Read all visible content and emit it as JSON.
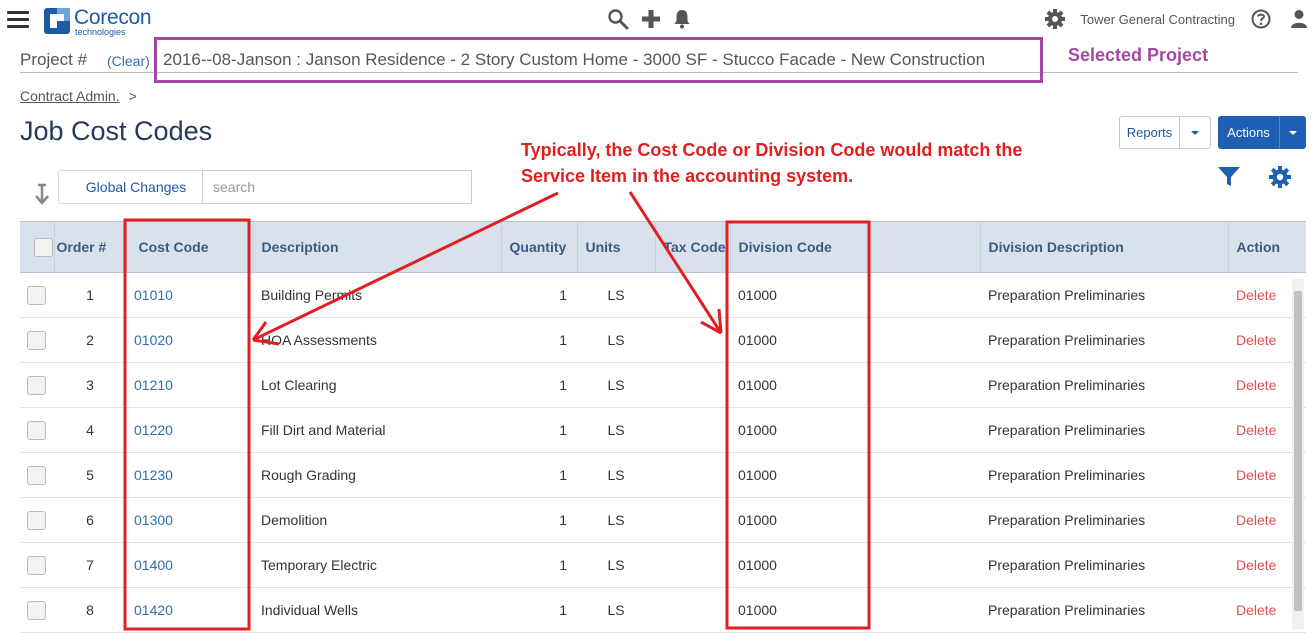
{
  "app": {
    "logo_name": "Corecon",
    "logo_sub": "technologies",
    "company": "Tower General Contracting"
  },
  "project": {
    "label": "Project #",
    "clear": "(Clear)",
    "name": "2016--08-Janson : Janson Residence - 2 Story Custom Home - 3000 SF - Stucco Facade - New Construction",
    "callout": "Selected Project"
  },
  "breadcrumb": {
    "item": "Contract Admin.",
    "separator": ">"
  },
  "page_title": "Job Cost Codes",
  "buttons": {
    "reports": "Reports",
    "actions": "Actions",
    "global_changes": "Global Changes"
  },
  "search": {
    "placeholder": "search"
  },
  "annotation": {
    "line1": "Typically, the Cost Code or Division Code would match the",
    "line2": "Service Item in the accounting system."
  },
  "table": {
    "headers": {
      "order": "Order #",
      "cost_code": "Cost Code",
      "description": "Description",
      "quantity": "Quantity",
      "units": "Units",
      "tax_code": "Tax Code",
      "division_code": "Division Code",
      "division_description": "Division Description",
      "action": "Action"
    },
    "rows": [
      {
        "order": "1",
        "cost_code": "01010",
        "description": "Building Permits",
        "quantity": "1",
        "units": "LS",
        "division_code": "01000",
        "division_description": "Preparation Preliminaries",
        "action": "Delete"
      },
      {
        "order": "2",
        "cost_code": "01020",
        "description": "HOA Assessments",
        "quantity": "1",
        "units": "LS",
        "division_code": "01000",
        "division_description": "Preparation Preliminaries",
        "action": "Delete"
      },
      {
        "order": "3",
        "cost_code": "01210",
        "description": "Lot Clearing",
        "quantity": "1",
        "units": "LS",
        "division_code": "01000",
        "division_description": "Preparation Preliminaries",
        "action": "Delete"
      },
      {
        "order": "4",
        "cost_code": "01220",
        "description": "Fill Dirt and Material",
        "quantity": "1",
        "units": "LS",
        "division_code": "01000",
        "division_description": "Preparation Preliminaries",
        "action": "Delete"
      },
      {
        "order": "5",
        "cost_code": "01230",
        "description": "Rough Grading",
        "quantity": "1",
        "units": "LS",
        "division_code": "01000",
        "division_description": "Preparation Preliminaries",
        "action": "Delete"
      },
      {
        "order": "6",
        "cost_code": "01300",
        "description": "Demolition",
        "quantity": "1",
        "units": "LS",
        "division_code": "01000",
        "division_description": "Preparation Preliminaries",
        "action": "Delete"
      },
      {
        "order": "7",
        "cost_code": "01400",
        "description": "Temporary Electric",
        "quantity": "1",
        "units": "LS",
        "division_code": "01000",
        "division_description": "Preparation Preliminaries",
        "action": "Delete"
      },
      {
        "order": "8",
        "cost_code": "01420",
        "description": "Individual Wells",
        "quantity": "1",
        "units": "LS",
        "division_code": "01000",
        "division_description": "Preparation Preliminaries",
        "action": "Delete"
      }
    ]
  },
  "colors": {
    "brand": "#1d5aa5",
    "callout_purple": "#a349a4",
    "annotation_red": "#e02020",
    "link_blue": "#2f6fae",
    "delete_red": "#e05050"
  },
  "icons": [
    "menu-icon",
    "search-icon",
    "plus-icon",
    "bell-icon",
    "gear-icon",
    "help-icon",
    "user-icon",
    "sort-arrow-icon",
    "filter-icon",
    "settings-icon"
  ]
}
